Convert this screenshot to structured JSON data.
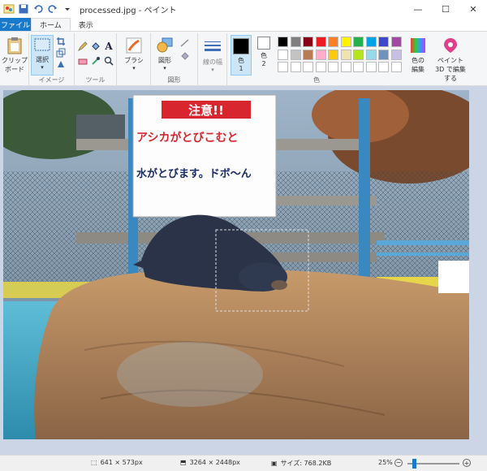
{
  "titlebar": {
    "title": "processed.jpg - ペイント",
    "minimize": "—",
    "maximize": "☐",
    "close": "✕"
  },
  "tabs": {
    "file": "ファイル",
    "home": "ホーム",
    "view": "表示"
  },
  "ribbon": {
    "clipboard": {
      "label": "クリップ ボード",
      "group": ""
    },
    "image": {
      "select": "選択",
      "group": "イメージ"
    },
    "tools": {
      "group": "ツール"
    },
    "brush": "ブラシ",
    "shapes": {
      "label": "図形",
      "group": "図形"
    },
    "size": "線の幅",
    "color1": "色 1",
    "color2": "色 2",
    "colors_group": "色",
    "edit_colors": "色の 編集",
    "paint3d": "ペイント 3D で編集する"
  },
  "colors": {
    "row1": [
      "#000000",
      "#7f7f7f",
      "#880015",
      "#ed1c24",
      "#ff7f27",
      "#fff200",
      "#22b14c",
      "#00a2e8",
      "#3f48cc",
      "#a349a4"
    ],
    "row2": [
      "#ffffff",
      "#c3c3c3",
      "#b97a57",
      "#ffaec9",
      "#ffc90e",
      "#efe4b0",
      "#b5e61d",
      "#99d9ea",
      "#7092be",
      "#c8bfe7"
    ],
    "row3": [
      "#ffffff",
      "#ffffff",
      "#ffffff",
      "#ffffff",
      "#ffffff",
      "#ffffff",
      "#ffffff",
      "#ffffff",
      "#ffffff",
      "#ffffff"
    ],
    "color1": "#000000",
    "color2": "#ffffff",
    "accent": "#1979ca"
  },
  "sign": {
    "heading": "注意!!",
    "line1": "アシカがとびこむと",
    "line2": "水がとびます。ドボ〜ん"
  },
  "statusbar": {
    "selection": "641 × 573px",
    "image_size": "3264 × 2448px",
    "file_size": "サイズ: 768.2KB",
    "zoom": "25%",
    "zoom_level": 0.25
  }
}
